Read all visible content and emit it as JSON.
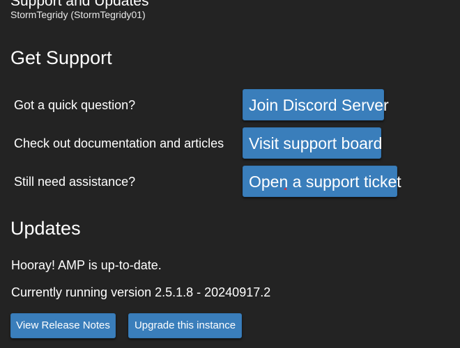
{
  "header": {
    "title": "Support and Updates",
    "user": "StormTegridy (StormTegridy01)"
  },
  "get_support": {
    "heading": "Get Support",
    "rows": [
      {
        "label": "Got a quick question?",
        "button": "Join Discord Server"
      },
      {
        "label": "Check out documentation and articles",
        "button": "Visit support board"
      },
      {
        "label": "Still need assistance?",
        "button": "Open a support ticket"
      }
    ]
  },
  "updates": {
    "heading": "Updates",
    "status": "Hooray! AMP is up-to-date.",
    "version_line": "Currently running version 2.5.1.8 - 20240917.2",
    "buttons": {
      "release_notes": "View Release Notes",
      "upgrade": "Upgrade this instance"
    }
  },
  "colors": {
    "background": "#232323",
    "button": "#3a7ebb",
    "text": "#ffffff"
  }
}
